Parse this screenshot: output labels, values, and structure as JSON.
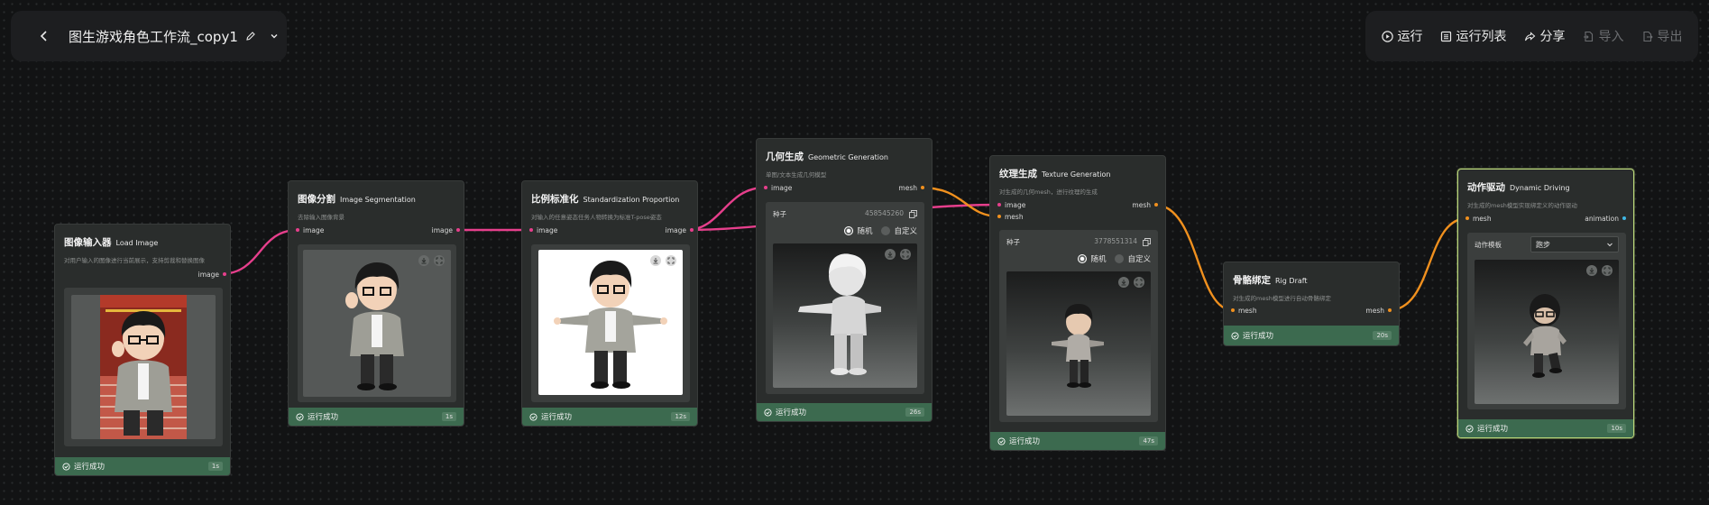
{
  "header": {
    "title": "图生游戏角色工作流_copy1",
    "actions": [
      {
        "label": "运行",
        "icon": "play-icon",
        "enabled": true
      },
      {
        "label": "运行列表",
        "icon": "list-icon",
        "enabled": true
      },
      {
        "label": "分享",
        "icon": "share-icon",
        "enabled": true
      },
      {
        "label": "导入",
        "icon": "import-icon",
        "enabled": false
      },
      {
        "label": "导出",
        "icon": "export-icon",
        "enabled": false
      }
    ]
  },
  "colors": {
    "image_port": "#e63f8c",
    "mesh_port": "#f0901e",
    "animation_port": "#3fb8e6",
    "success": "#3c6a4f",
    "selected_border": "#b9d67a"
  },
  "nodes": {
    "load_image": {
      "title": "图像输入器",
      "title_en": "Load Image",
      "desc": "对用户输入的图像进行当前展示，支持剪裁和替换图像",
      "out_port": "image",
      "status": "运行成功",
      "time": "1s"
    },
    "segmentation": {
      "title": "图像分割",
      "title_en": "Image Segmentation",
      "desc": "去除输入图像背景",
      "in_port": "image",
      "out_port": "image",
      "status": "运行成功",
      "time": "1s"
    },
    "standardization": {
      "title": "比例标准化",
      "title_en": "Standardization Proportion",
      "desc": "对输入的任意姿态任务人物转换为标准T-pose姿态",
      "in_port": "image",
      "out_port": "image",
      "status": "运行成功",
      "time": "12s"
    },
    "geometric": {
      "title": "几何生成",
      "title_en": "Geometric Generation",
      "desc": "单图/文本生成几何模型",
      "in_port": "image",
      "out_port": "mesh",
      "seed_label": "种子",
      "seed_value": "458545260",
      "radio_random": "随机",
      "radio_custom": "自定义",
      "status": "运行成功",
      "time": "26s"
    },
    "texture": {
      "title": "纹理生成",
      "title_en": "Texture Generation",
      "desc": "对生成的几何mesh，进行纹理的生成",
      "in_port_1": "image",
      "in_port_2": "mesh",
      "out_port": "mesh",
      "seed_label": "种子",
      "seed_value": "3778551314",
      "radio_random": "随机",
      "radio_custom": "自定义",
      "status": "运行成功",
      "time": "47s"
    },
    "rig": {
      "title": "骨骼绑定",
      "title_en": "Rig Draft",
      "desc": "对生成的mesh模型进行自动骨骼绑定",
      "in_port": "mesh",
      "out_port": "mesh",
      "status": "运行成功",
      "time": "20s"
    },
    "driving": {
      "title": "动作驱动",
      "title_en": "Dynamic Driving",
      "desc": "对生成的mesh模型实现绑定义的动作驱动",
      "in_port": "mesh",
      "out_port": "animation",
      "template_label": "动作模板",
      "template_value": "跑步",
      "status": "运行成功",
      "time": "10s"
    }
  }
}
